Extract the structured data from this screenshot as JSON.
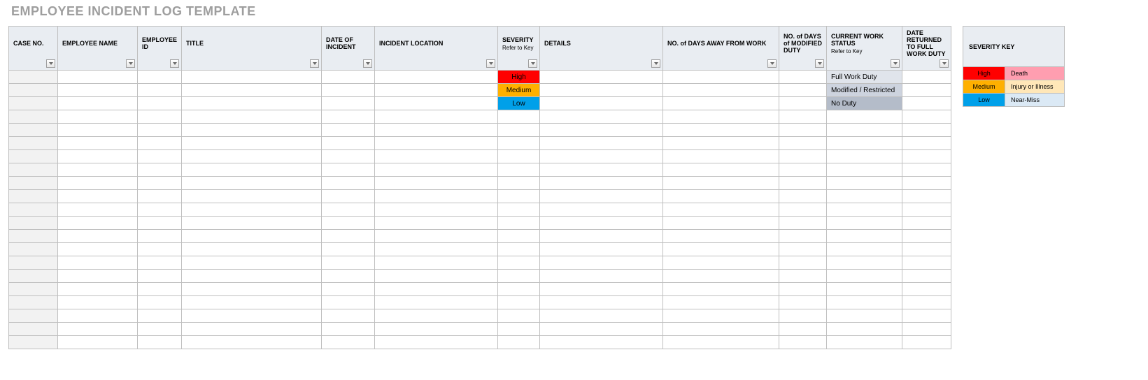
{
  "title": "EMPLOYEE INCIDENT LOG TEMPLATE",
  "columns": [
    {
      "label": "CASE NO.",
      "cls": "c-case",
      "filter": true
    },
    {
      "label": "EMPLOYEE NAME",
      "cls": "c-name",
      "filter": true
    },
    {
      "label": "EMPLOYEE ID",
      "cls": "c-id hdr-center",
      "filter": true
    },
    {
      "label": "TITLE",
      "cls": "c-title",
      "filter": true
    },
    {
      "label": "DATE OF INCIDENT",
      "cls": "c-date hdr-center",
      "filter": true
    },
    {
      "label": "INCIDENT LOCATION",
      "cls": "c-loc",
      "filter": true
    },
    {
      "label": "SEVERITY",
      "sub": "Refer to Key",
      "cls": "c-sev",
      "filter": true
    },
    {
      "label": "DETAILS",
      "cls": "c-det",
      "filter": true
    },
    {
      "label": "NO. of DAYS AWAY FROM WORK",
      "cls": "c-days",
      "filter": true
    },
    {
      "label": "NO. of DAYS of MODIFIED DUTY",
      "cls": "c-mod hdr-center",
      "filter": true
    },
    {
      "label": "CURRENT WORK STATUS",
      "sub": "Refer to Key",
      "cls": "c-cws",
      "filter": true
    },
    {
      "label": "DATE RETURNED TO FULL WORK DUTY",
      "cls": "c-ret hdr-center",
      "filter": true
    }
  ],
  "rows": [
    {
      "severity": "High",
      "sev_cls": "sev-high",
      "cws": "Full Work Duty",
      "cws_cls": "cws-full"
    },
    {
      "severity": "Medium",
      "sev_cls": "sev-med",
      "cws": "Modified / Restricted",
      "cws_cls": "cws-mod"
    },
    {
      "severity": "Low",
      "sev_cls": "sev-low",
      "cws": "No Duty",
      "cws_cls": "cws-none"
    }
  ],
  "empty_rows": 18,
  "severity_key": {
    "header": "SEVERITY KEY",
    "rows": [
      {
        "sev": "High",
        "sev_cls": "sev-high",
        "desc": "Death",
        "desc_cls": "key-death"
      },
      {
        "sev": "Medium",
        "sev_cls": "sev-med",
        "desc": "Injury or Illness",
        "desc_cls": "key-inj"
      },
      {
        "sev": "Low",
        "sev_cls": "sev-low",
        "desc": "Near-Miss",
        "desc_cls": "key-nm"
      }
    ]
  }
}
